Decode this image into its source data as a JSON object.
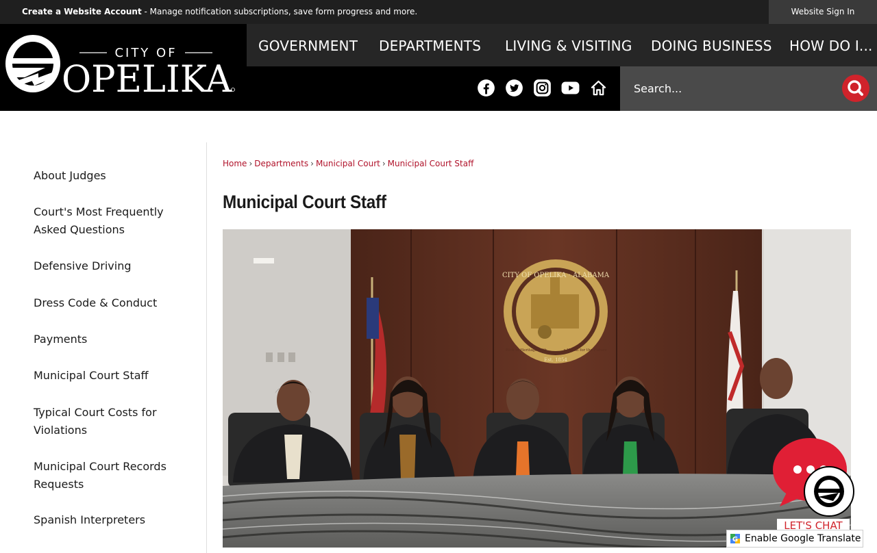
{
  "topbar": {
    "notice_bold": "Create a Website Account",
    "notice_rest": " - Manage notification subscriptions, save form progress and more.",
    "signin_label": "Website Sign In"
  },
  "logo": {
    "line1": "CITY OF",
    "line2": "OPELIKA"
  },
  "nav": [
    "GOVERNMENT",
    "DEPARTMENTS",
    "LIVING & VISITING",
    "DOING BUSINESS",
    "HOW DO I..."
  ],
  "social_icons": [
    "facebook-icon",
    "twitter-icon",
    "instagram-icon",
    "youtube-icon",
    "home-icon"
  ],
  "search": {
    "placeholder": "Search..."
  },
  "sidebar": {
    "items": [
      "About Judges",
      "Court's Most Frequently Asked Questions",
      "Defensive Driving",
      "Dress Code & Conduct",
      "Payments",
      "Municipal Court Staff",
      "Typical Court Costs for Violations",
      "Municipal Court Records Requests",
      "Spanish Interpreters"
    ]
  },
  "breadcrumb": [
    "Home",
    "Departments",
    "Municipal Court",
    "Municipal Court Staff"
  ],
  "page_title": "Municipal Court Staff",
  "photo": {
    "seal_text_top": "CITY OF OPELIKA · ALABAMA",
    "seal_text_left": "Rich in Heritage with",
    "seal_text_right": "a Vision for the Future",
    "seal_est": "Est. 1854"
  },
  "chat": {
    "label": "LET'S CHAT"
  },
  "translate": {
    "label": "Enable Google Translate"
  },
  "colors": {
    "accent": "#d0232b",
    "link": "#b0122a",
    "header_bg": "#000000",
    "nav_bg": "#262626"
  }
}
